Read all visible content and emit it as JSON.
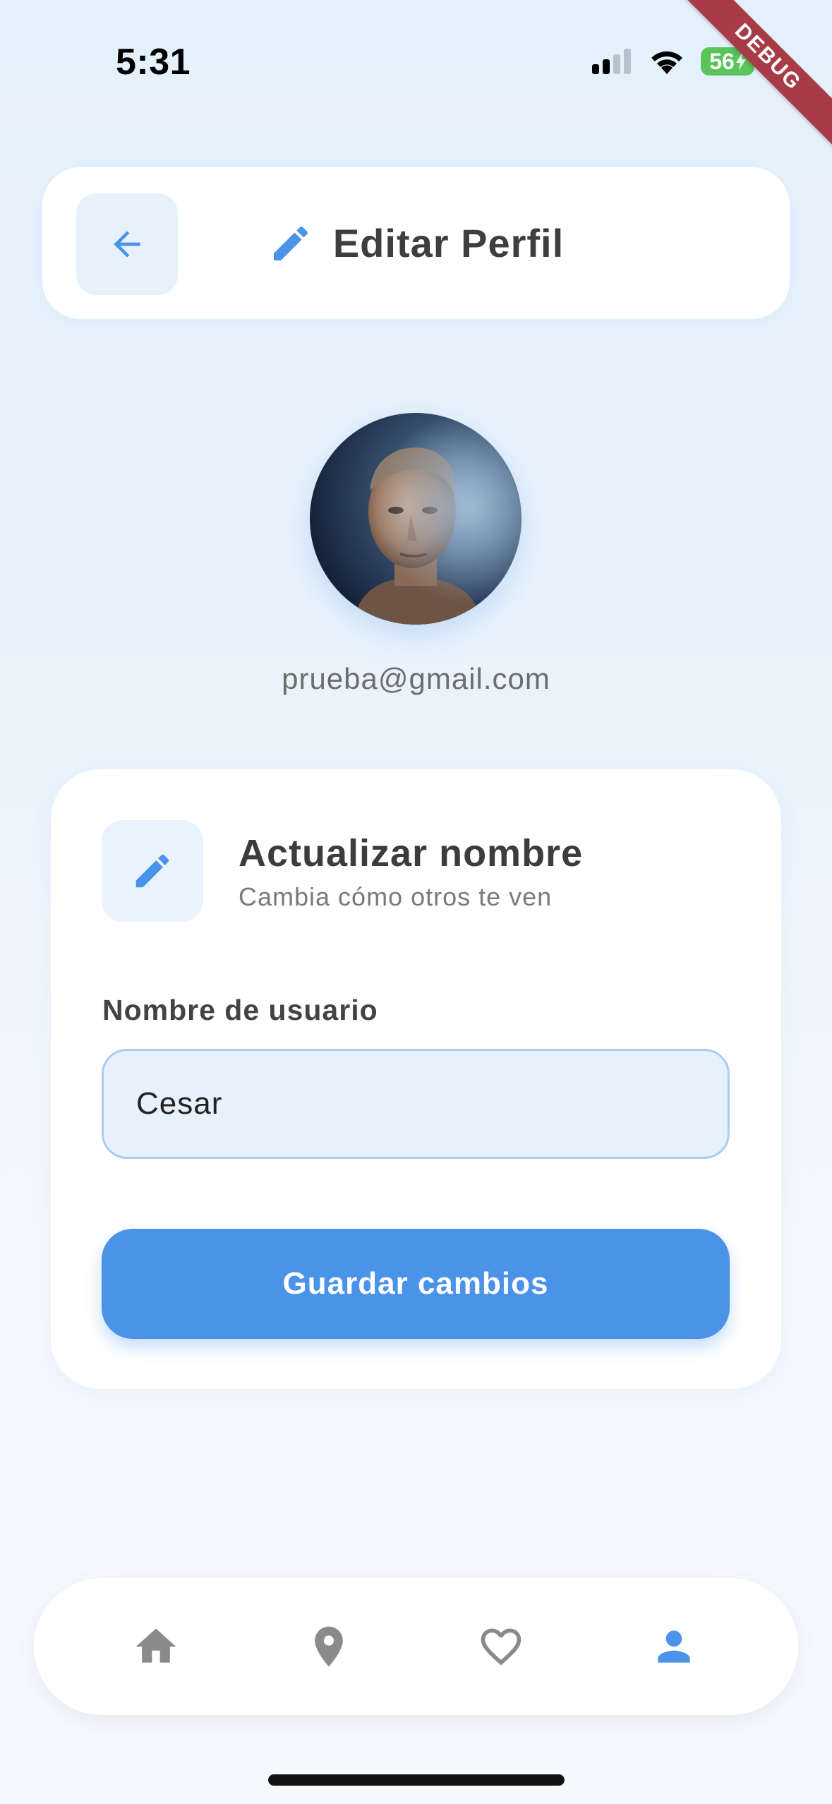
{
  "status_bar": {
    "time": "5:31",
    "battery": "56"
  },
  "debug_banner": "DEBUG",
  "header": {
    "title": "Editar Perfil"
  },
  "profile": {
    "email": "prueba@gmail.com"
  },
  "form": {
    "title": "Actualizar nombre",
    "subtitle": "Cambia cómo otros te ven",
    "field_label": "Nombre de usuario",
    "username_value": "Cesar",
    "save_label": "Guardar cambios"
  },
  "bottom_nav": {
    "items": [
      {
        "icon": "home-icon",
        "active": false
      },
      {
        "icon": "location-pin-icon",
        "active": false
      },
      {
        "icon": "heart-outline-icon",
        "active": false
      },
      {
        "icon": "person-icon",
        "active": true
      }
    ]
  },
  "colors": {
    "accent": "#4a93e8",
    "inactive_icon": "#8a8a8a",
    "debug_ribbon": "#a83b45",
    "battery": "#5ac35a"
  }
}
